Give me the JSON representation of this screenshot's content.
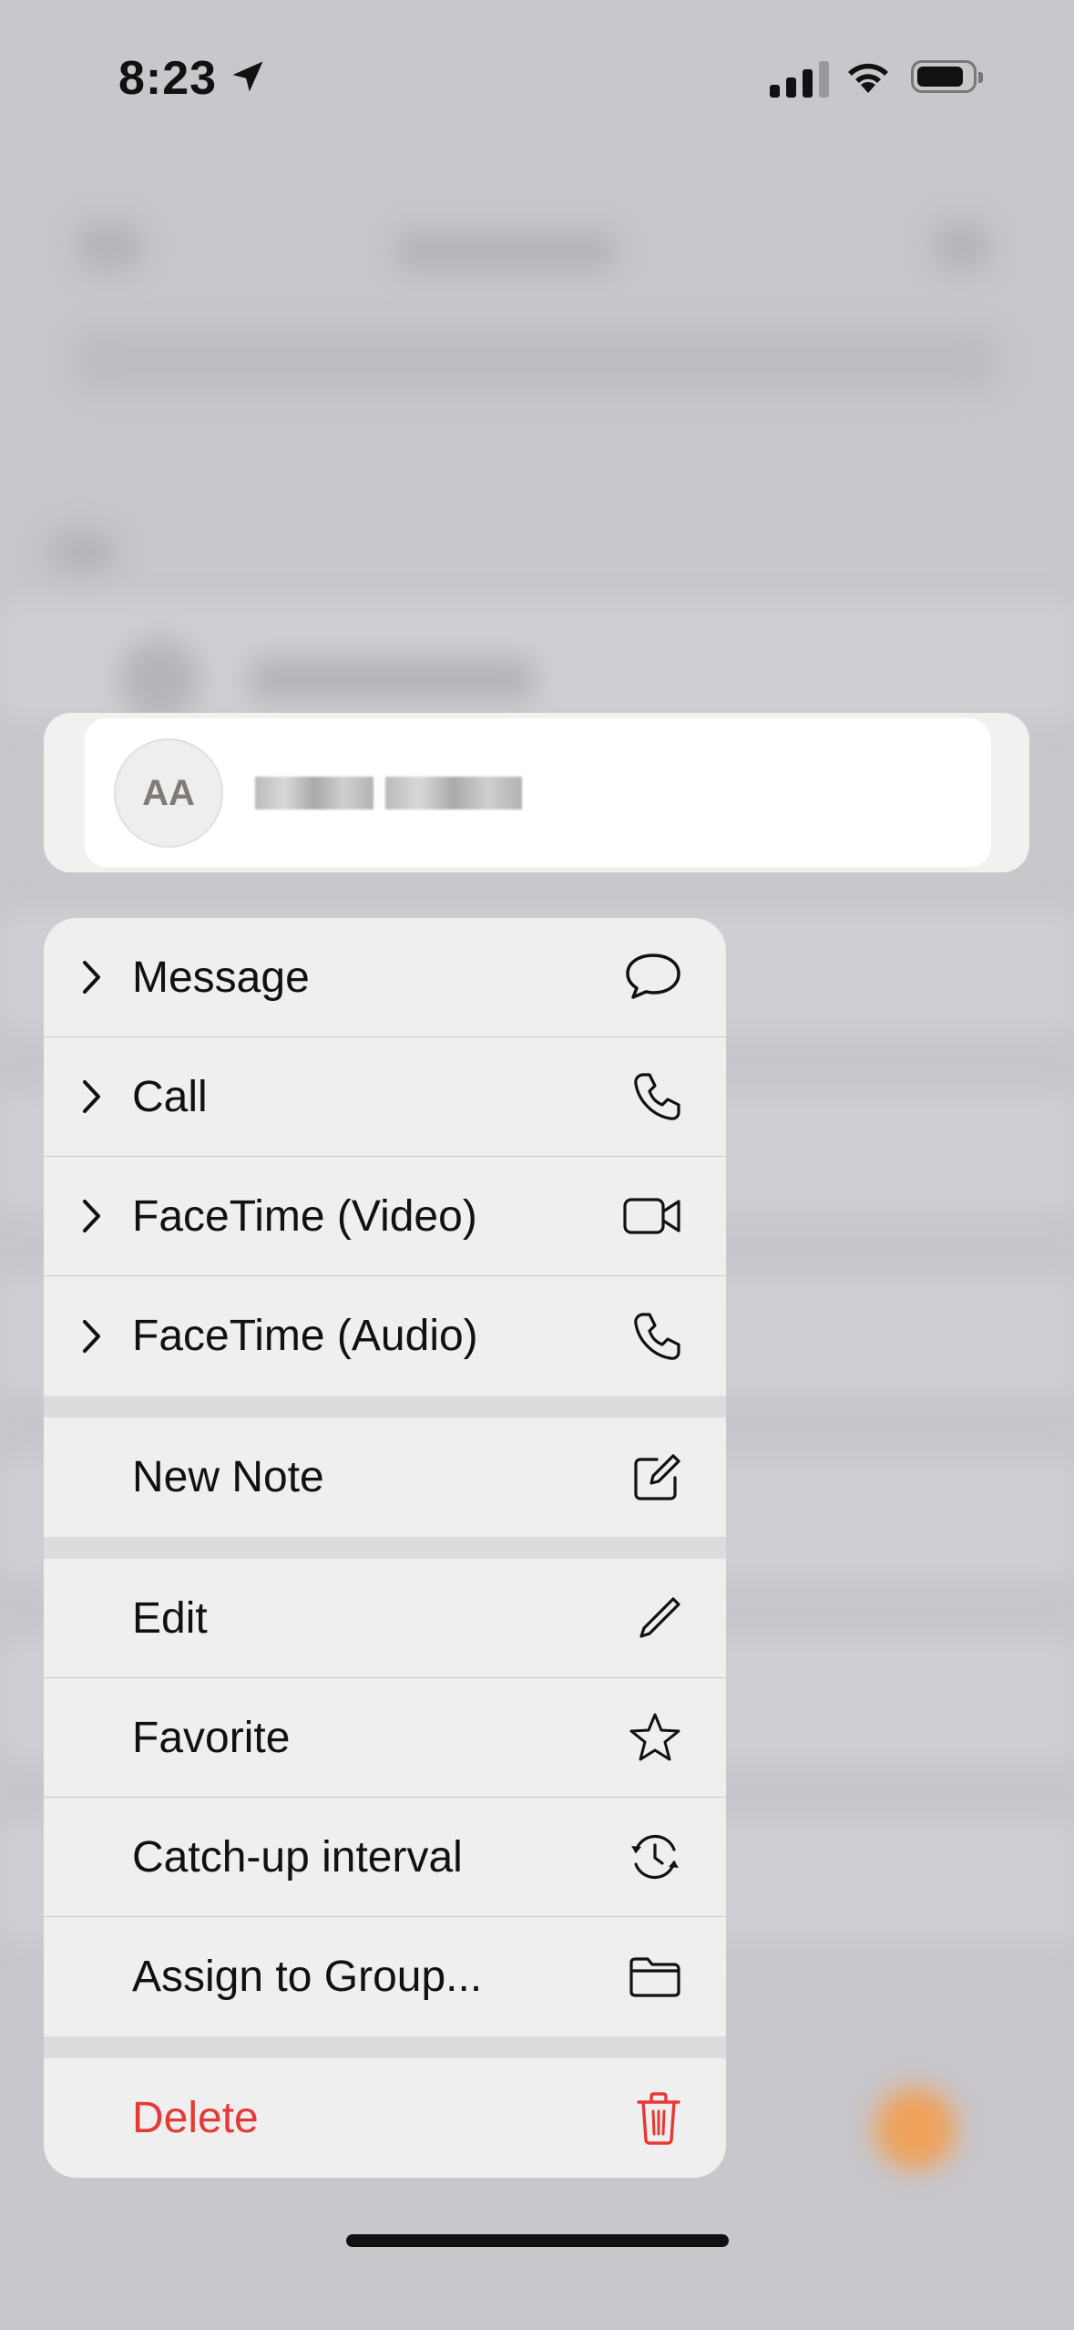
{
  "status_bar": {
    "time": "8:23"
  },
  "contact": {
    "initials": "AA"
  },
  "menu": {
    "items": [
      {
        "label": "Message",
        "icon": "message-bubble-icon"
      },
      {
        "label": "Call",
        "icon": "phone-icon"
      },
      {
        "label": "FaceTime (Video)",
        "icon": "video-camera-icon"
      },
      {
        "label": "FaceTime (Audio)",
        "icon": "phone-icon"
      },
      {
        "label": "New Note",
        "icon": "compose-icon"
      },
      {
        "label": "Edit",
        "icon": "pencil-icon"
      },
      {
        "label": "Favorite",
        "icon": "star-icon"
      },
      {
        "label": "Catch-up interval",
        "icon": "clock-arrows-icon"
      },
      {
        "label": "Assign to Group...",
        "icon": "folder-icon"
      },
      {
        "label": "Delete",
        "icon": "trash-icon"
      }
    ]
  },
  "colors": {
    "destructive": "#e53935",
    "accent_bg": "#f0a15a"
  }
}
